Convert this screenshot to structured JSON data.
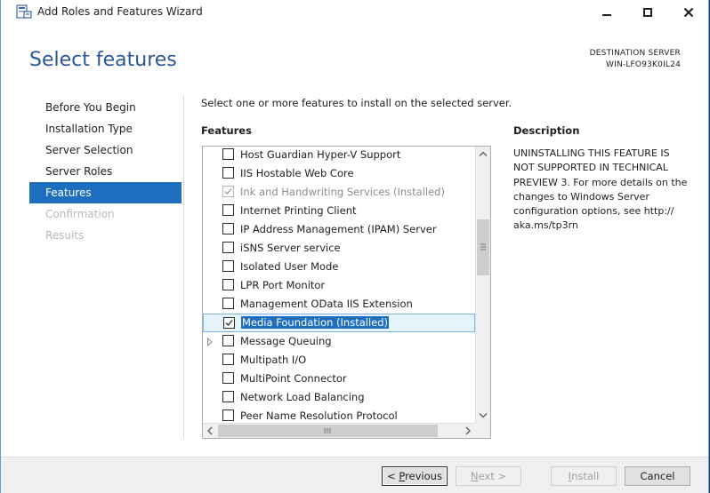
{
  "window": {
    "title": "Add Roles and Features Wizard"
  },
  "header": {
    "page_title": "Select features",
    "destination_label": "DESTINATION SERVER",
    "destination_value": "WIN-LFO93K0IL24"
  },
  "nav": {
    "items": [
      {
        "label": "Before You Begin",
        "state": "normal"
      },
      {
        "label": "Installation Type",
        "state": "normal"
      },
      {
        "label": "Server Selection",
        "state": "normal"
      },
      {
        "label": "Server Roles",
        "state": "normal"
      },
      {
        "label": "Features",
        "state": "active"
      },
      {
        "label": "Confirmation",
        "state": "disabled"
      },
      {
        "label": "Results",
        "state": "disabled"
      }
    ]
  },
  "main": {
    "instruction": "Select one or more features to install on the selected server.",
    "features_heading": "Features",
    "description_heading": "Description",
    "description_text": "UNINSTALLING THIS FEATURE IS NOT SUPPORTED IN TECHNICAL PREVIEW 3. For more details on the changes to Windows Server configuration options, see http:// aka.ms/tp3rn"
  },
  "features": [
    {
      "label": "Host Guardian Hyper-V Support",
      "checked": false,
      "disabled": false,
      "expandable": false
    },
    {
      "label": "IIS Hostable Web Core",
      "checked": false,
      "disabled": false,
      "expandable": false
    },
    {
      "label": "Ink and Handwriting Services (Installed)",
      "checked": true,
      "disabled": true,
      "expandable": false
    },
    {
      "label": "Internet Printing Client",
      "checked": false,
      "disabled": false,
      "expandable": false
    },
    {
      "label": "IP Address Management (IPAM) Server",
      "checked": false,
      "disabled": false,
      "expandable": false
    },
    {
      "label": "iSNS Server service",
      "checked": false,
      "disabled": false,
      "expandable": false
    },
    {
      "label": "Isolated User Mode",
      "checked": false,
      "disabled": false,
      "expandable": false
    },
    {
      "label": "LPR Port Monitor",
      "checked": false,
      "disabled": false,
      "expandable": false
    },
    {
      "label": "Management OData IIS Extension",
      "checked": false,
      "disabled": false,
      "expandable": false
    },
    {
      "label": "Media Foundation (Installed)",
      "checked": true,
      "disabled": false,
      "expandable": false,
      "selected": true
    },
    {
      "label": "Message Queuing",
      "checked": false,
      "disabled": false,
      "expandable": true
    },
    {
      "label": "Multipath I/O",
      "checked": false,
      "disabled": false,
      "expandable": false
    },
    {
      "label": "MultiPoint Connector",
      "checked": false,
      "disabled": false,
      "expandable": false
    },
    {
      "label": "Network Load Balancing",
      "checked": false,
      "disabled": false,
      "expandable": false
    },
    {
      "label": "Peer Name Resolution Protocol",
      "checked": false,
      "disabled": false,
      "expandable": false
    }
  ],
  "footer": {
    "previous_label": "< Previous",
    "next_label": "Next >",
    "install_label": "Install",
    "cancel_label": "Cancel"
  },
  "colors": {
    "accent": "#1e6ebf",
    "title_blue": "#2b5797"
  },
  "icons": {
    "app": "server-manager-icon",
    "minimize": "minimize-icon",
    "maximize": "maximize-icon",
    "close": "close-icon"
  }
}
